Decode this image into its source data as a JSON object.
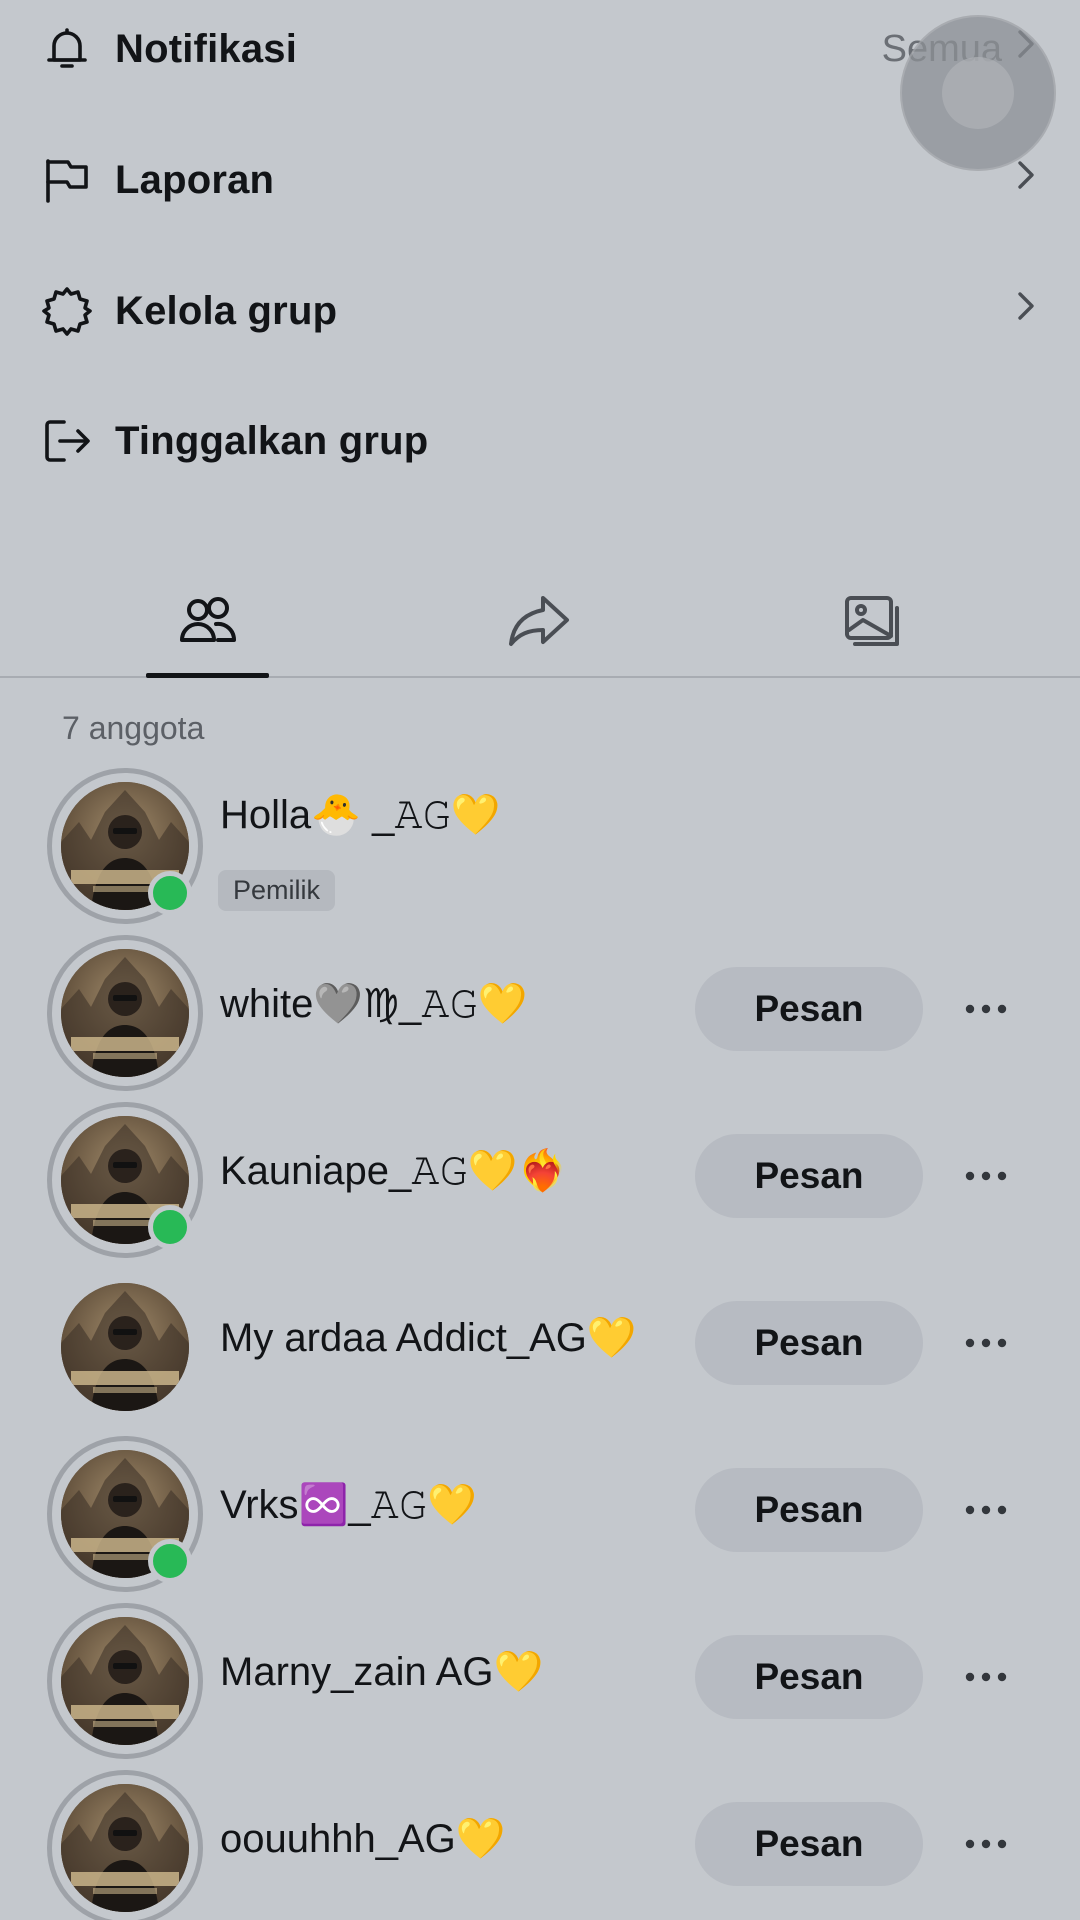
{
  "menu": {
    "notifications": {
      "label": "Notifikasi",
      "value": "Semua",
      "icon": "bell-icon"
    },
    "report": {
      "label": "Laporan",
      "icon": "flag-icon"
    },
    "manage": {
      "label": "Kelola grup",
      "icon": "gear-icon"
    },
    "leave": {
      "label": "Tinggalkan grup",
      "icon": "leave-icon"
    }
  },
  "tabs": [
    {
      "icon": "members-icon",
      "active": true
    },
    {
      "icon": "share-icon",
      "active": false
    },
    {
      "icon": "media-icon",
      "active": false
    }
  ],
  "member_count": "7 anggota",
  "members": [
    {
      "name": "Holla🐣 _𝙰𝙶💛",
      "badge": "Pemilik",
      "online": true
    },
    {
      "name": "white🩶♍_𝙰𝙶💛",
      "button": "Pesan",
      "online": false
    },
    {
      "name": "Kauniape_𝙰𝙶💛❤️‍🔥",
      "button": "Pesan",
      "online": true
    },
    {
      "name": "My ardaa Addict_AG💛",
      "button": "Pesan",
      "online": false
    },
    {
      "name": "Vrks♾️_𝙰𝙶💛",
      "button": "Pesan",
      "online": true
    },
    {
      "name": "Marny_zain AG💛",
      "button": "Pesan",
      "online": false
    },
    {
      "name": "oouuhhh_AG💛",
      "button": "Pesan",
      "online": false
    }
  ],
  "colors": {
    "online": "#28b956",
    "background": "#c4c8cd",
    "button": "#b7bbc2"
  }
}
